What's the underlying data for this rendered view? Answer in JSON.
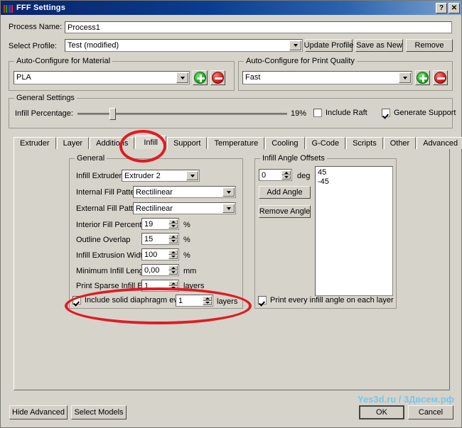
{
  "window": {
    "title": "FFF Settings",
    "icon": "color-bars-icon",
    "help_button": "?",
    "close_button": "✕",
    "icon_colors": [
      "#d62b2b",
      "#19a019",
      "#1f49c0",
      "#8a27b5",
      "#d62b2b"
    ]
  },
  "header": {
    "process_name_label": "Process Name:",
    "process_name_value": "Process1",
    "select_profile_label": "Select Profile:",
    "select_profile_value": "Test (modified)",
    "update_profile_label": "Update Profile",
    "save_as_new_label": "Save as New",
    "remove_label": "Remove"
  },
  "auto_material": {
    "caption": "Auto-Configure for Material",
    "value": "PLA",
    "add_icon": "plus-circle-icon",
    "remove_icon": "minus-circle-icon"
  },
  "auto_quality": {
    "caption": "Auto-Configure for Print Quality",
    "value": "Fast",
    "add_icon": "plus-circle-icon",
    "remove_icon": "minus-circle-icon"
  },
  "general_settings": {
    "caption": "General Settings",
    "infill_label": "Infill Percentage:",
    "infill_value": "19%",
    "infill_percent": 19,
    "include_raft_label": "Include Raft",
    "include_raft_checked": false,
    "generate_support_label": "Generate Support",
    "generate_support_checked": true
  },
  "tabs": [
    {
      "label": "Extruder",
      "selected": false
    },
    {
      "label": "Layer",
      "selected": false
    },
    {
      "label": "Additions",
      "selected": false
    },
    {
      "label": "Infill",
      "selected": true
    },
    {
      "label": "Support",
      "selected": false
    },
    {
      "label": "Temperature",
      "selected": false
    },
    {
      "label": "Cooling",
      "selected": false
    },
    {
      "label": "G-Code",
      "selected": false
    },
    {
      "label": "Scripts",
      "selected": false
    },
    {
      "label": "Other",
      "selected": false
    },
    {
      "label": "Advanced",
      "selected": false
    }
  ],
  "general_group": {
    "caption": "General",
    "rows": [
      {
        "label": "Infill Extruder",
        "value": "Extruder 2",
        "type": "combo",
        "unit": ""
      },
      {
        "label": "Internal Fill Pattern",
        "value": "Rectilinear",
        "type": "combo",
        "unit": ""
      },
      {
        "label": "External Fill Pattern",
        "value": "Rectilinear",
        "type": "combo",
        "unit": ""
      },
      {
        "label": "Interior Fill Percentage",
        "value": "19",
        "type": "spin",
        "unit": "%"
      },
      {
        "label": "Outline Overlap",
        "value": "15",
        "type": "spin",
        "unit": "%"
      },
      {
        "label": "Infill Extrusion Width",
        "value": "100",
        "type": "spin",
        "unit": "%"
      },
      {
        "label": "Minimum Infill Length",
        "value": "0,00",
        "type": "spin",
        "unit": "mm"
      },
      {
        "label": "Print Sparse Infill Every",
        "value": "1",
        "type": "spin",
        "unit": "layers"
      }
    ],
    "diaphragm": {
      "checked": true,
      "label": "Include solid diaphragm every",
      "value": "1",
      "unit": "layers"
    }
  },
  "angle_group": {
    "caption": "Infill Angle Offsets",
    "deg_value": "0",
    "deg_unit": "deg",
    "add_angle_label": "Add Angle",
    "remove_angle_label": "Remove Angle",
    "angles": [
      "45",
      "-45"
    ],
    "print_every_label": "Print every infill angle on each layer",
    "print_every_checked": true
  },
  "footer": {
    "hide_advanced_label": "Hide Advanced",
    "select_models_label": "Select Models",
    "ok_label": "OK",
    "cancel_label": "Cancel"
  },
  "watermark": {
    "text": "Yes3d.ru / 3Двсем.рф",
    "color": "#6cc4f0"
  },
  "annotations": {
    "highlight_color": "#e01b24",
    "ellipse_infill_tab": "red-ellipse-infill-tab",
    "ellipse_diaphragm": "red-ellipse-diaphragm-row"
  }
}
